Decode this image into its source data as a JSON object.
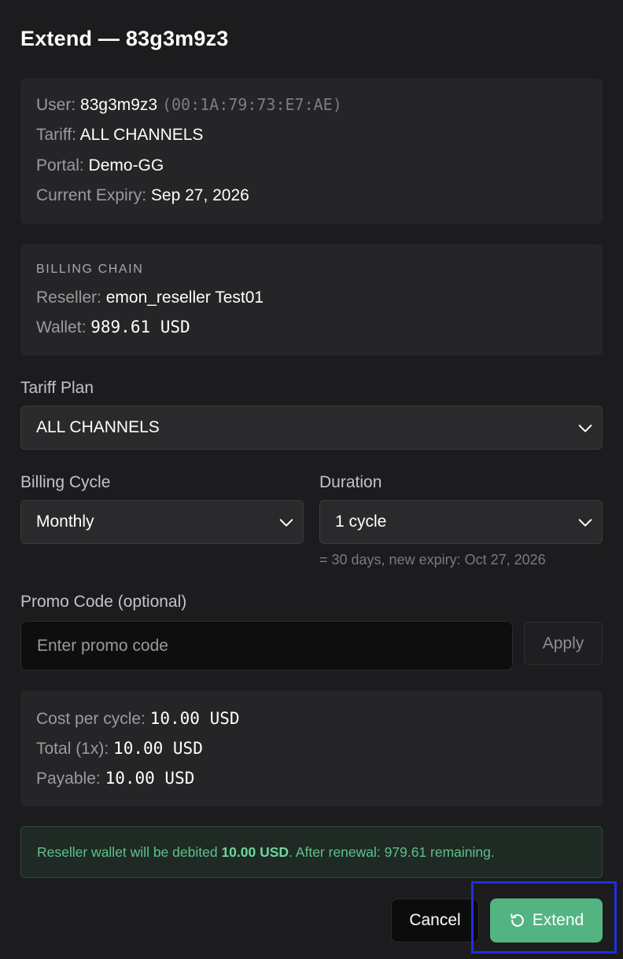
{
  "dialog": {
    "title": "Extend — 83g3m9z3"
  },
  "user_info": {
    "user_label": "User:",
    "user_value": "83g3m9z3",
    "mac": "(00:1A:79:73:E7:AE)",
    "tariff_label": "Tariff:",
    "tariff_value": "ALL CHANNELS",
    "portal_label": "Portal:",
    "portal_value": "Demo-GG",
    "expiry_label": "Current Expiry:",
    "expiry_value": "Sep 27, 2026"
  },
  "billing_chain": {
    "heading": "BILLING CHAIN",
    "reseller_label": "Reseller:",
    "reseller_value": "emon_reseller Test01",
    "wallet_label": "Wallet:",
    "wallet_value": "989.61 USD"
  },
  "form": {
    "tariff_plan_label": "Tariff Plan",
    "tariff_plan_value": "ALL CHANNELS",
    "billing_cycle_label": "Billing Cycle",
    "billing_cycle_value": "Monthly",
    "duration_label": "Duration",
    "duration_value": "1 cycle",
    "duration_hint": "= 30 days, new expiry: Oct 27, 2026",
    "promo_label": "Promo Code (optional)",
    "promo_placeholder": "Enter promo code",
    "promo_value": "",
    "apply_label": "Apply"
  },
  "cost": {
    "per_cycle_label": "Cost per cycle:",
    "per_cycle_value": "10.00 USD",
    "total_label": "Total (1x):",
    "total_value": "10.00 USD",
    "payable_label": "Payable:",
    "payable_value": "10.00 USD"
  },
  "notice": {
    "prefix": "Reseller wallet will be debited",
    "amount": "10.00 USD",
    "suffix": ". After renewal: 979.61 remaining."
  },
  "actions": {
    "cancel_label": "Cancel",
    "extend_label": "Extend",
    "extend_icon": "refresh-icon"
  },
  "colors": {
    "background": "#1c1c1e",
    "accent_green": "#53b482",
    "focus_ring": "#1f2fe0"
  }
}
